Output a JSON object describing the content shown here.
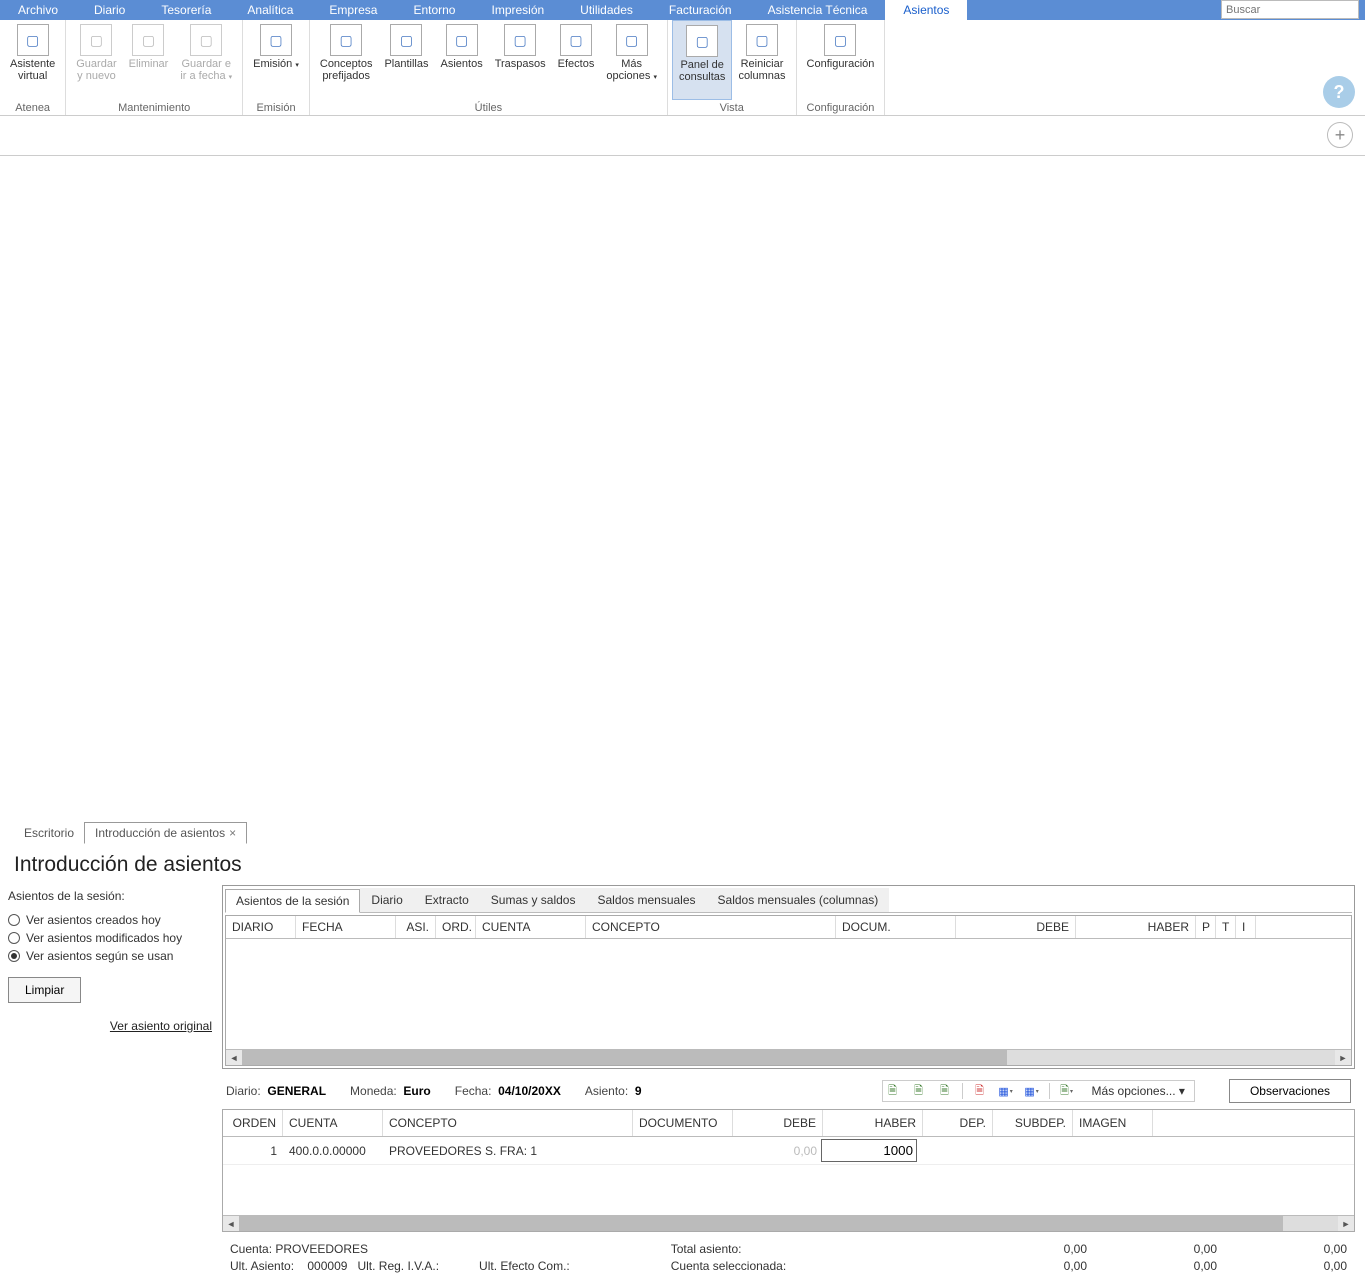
{
  "menu": [
    "Archivo",
    "Diario",
    "Tesorería",
    "Analítica",
    "Empresa",
    "Entorno",
    "Impresión",
    "Utilidades",
    "Facturación",
    "Asistencia Técnica",
    "Asientos"
  ],
  "active_menu": "Asientos",
  "search_placeholder": "Buscar",
  "ribbon": {
    "groups": [
      {
        "label": "Atenea",
        "buttons": [
          {
            "id": "asistente",
            "label": "Asistente\nvirtual"
          }
        ]
      },
      {
        "label": "Mantenimiento",
        "buttons": [
          {
            "id": "guardar-nuevo",
            "label": "Guardar\ny nuevo",
            "disabled": true
          },
          {
            "id": "eliminar",
            "label": "Eliminar",
            "disabled": true
          },
          {
            "id": "guardar-fecha",
            "label": "Guardar e\nir a fecha",
            "disabled": true,
            "dd": true
          }
        ]
      },
      {
        "label": "Emisión",
        "buttons": [
          {
            "id": "emision",
            "label": "Emisión",
            "dd": true
          }
        ]
      },
      {
        "label": "Útiles",
        "buttons": [
          {
            "id": "conceptos",
            "label": "Conceptos\nprefijados"
          },
          {
            "id": "plantillas",
            "label": "Plantillas"
          },
          {
            "id": "asientos",
            "label": "Asientos"
          },
          {
            "id": "traspasos",
            "label": "Traspasos"
          },
          {
            "id": "efectos",
            "label": "Efectos"
          },
          {
            "id": "mas-opciones",
            "label": "Más\nopciones",
            "dd": true
          }
        ]
      },
      {
        "label": "Vista",
        "buttons": [
          {
            "id": "panel-consultas",
            "label": "Panel de\nconsultas",
            "active": true
          },
          {
            "id": "reiniciar",
            "label": "Reiniciar\ncolumnas"
          }
        ]
      },
      {
        "label": "Configuración",
        "buttons": [
          {
            "id": "config",
            "label": "Configuración"
          }
        ]
      }
    ]
  },
  "doc_tabs": [
    {
      "label": "Escritorio"
    },
    {
      "label": "Introducción de asientos",
      "active": true,
      "closable": true
    }
  ],
  "page_title": "Introducción de asientos",
  "sidebar": {
    "title": "Asientos de la sesión:",
    "radios": [
      {
        "label": "Ver asientos creados hoy"
      },
      {
        "label": "Ver asientos modificados hoy"
      },
      {
        "label": "Ver asientos según se usan",
        "checked": true
      }
    ],
    "clear_label": "Limpiar",
    "link": "Ver asiento original"
  },
  "subtabs": [
    "Asientos de la sesión",
    "Diario",
    "Extracto",
    "Sumas y saldos",
    "Saldos mensuales",
    "Saldos mensuales (columnas)"
  ],
  "active_subtab": "Asientos de la sesión",
  "grid_cols": [
    "DIARIO",
    "FECHA",
    "ASI.",
    "ORD.",
    "CUENTA",
    "CONCEPTO",
    "DOCUM.",
    "DEBE",
    "HABER",
    "P",
    "T",
    "I"
  ],
  "entry_bar": {
    "diario_label": "Diario:",
    "diario_value": "GENERAL",
    "moneda_label": "Moneda:",
    "moneda_value": "Euro",
    "fecha_label": "Fecha:",
    "fecha_value": "04/10/20XX",
    "asiento_label": "Asiento:",
    "asiento_value": "9",
    "more": "Más opciones...",
    "obs": "Observaciones"
  },
  "entry_cols": [
    "ORDEN",
    "CUENTA",
    "CONCEPTO",
    "DOCUMENTO",
    "DEBE",
    "HABER",
    "DEP.",
    "SUBDEP.",
    "IMAGEN"
  ],
  "entry_row": {
    "orden": "1",
    "cuenta": "400.0.0.00000",
    "concepto": "PROVEEDORES S. FRA:  1",
    "documento": "",
    "debe": "0,00",
    "haber": "1000"
  },
  "footer": {
    "cuenta_lbl": "Cuenta:",
    "cuenta_val": "PROVEEDORES",
    "ult_asiento_lbl": "Ult. Asiento:",
    "ult_asiento_val": "000009",
    "ult_reg_lbl": "Ult. Reg. I.V.A.:",
    "ult_efecto_lbl": "Ult. Efecto Com.:",
    "total_lbl": "Total asiento:",
    "cuenta_sel_lbl": "Cuenta seleccionada:",
    "vals": [
      "0,00",
      "0,00",
      "0,00",
      "0,00",
      "0,00",
      "0,00"
    ]
  }
}
